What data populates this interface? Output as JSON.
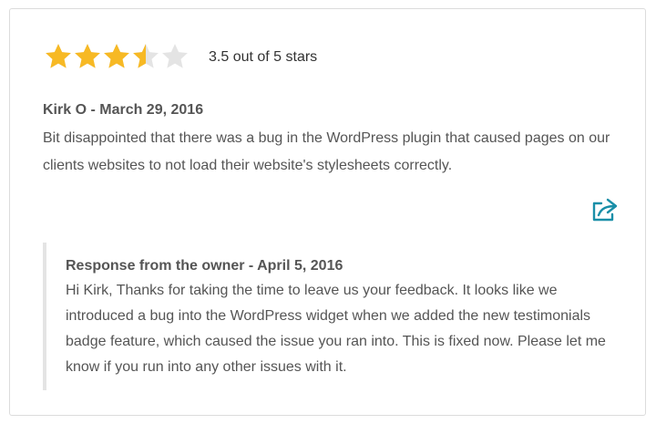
{
  "review": {
    "rating": 3.5,
    "max_rating": 5,
    "rating_text": "3.5 out of 5 stars",
    "author_date": "Kirk O - March 29, 2016",
    "body": "Bit disappointed that there was a bug in the WordPress plugin that caused pages on our clients websites to not load their website's stylesheets correctly.",
    "share_icon": "share-icon",
    "colors": {
      "star_filled": "#f7b924",
      "star_empty": "#e4e4e4",
      "share_accent": "#1a8fa8",
      "quote_bar": "#e4e4e4"
    }
  },
  "owner_response": {
    "heading": "Response from the owner - April 5, 2016",
    "body": "Hi Kirk, Thanks for taking the time to leave us your feedback. It looks like we introduced a bug into the WordPress widget when we added the new testimonials badge feature, which caused the issue you ran into. This is fixed now. Please let me know if you run into any other issues with it."
  }
}
